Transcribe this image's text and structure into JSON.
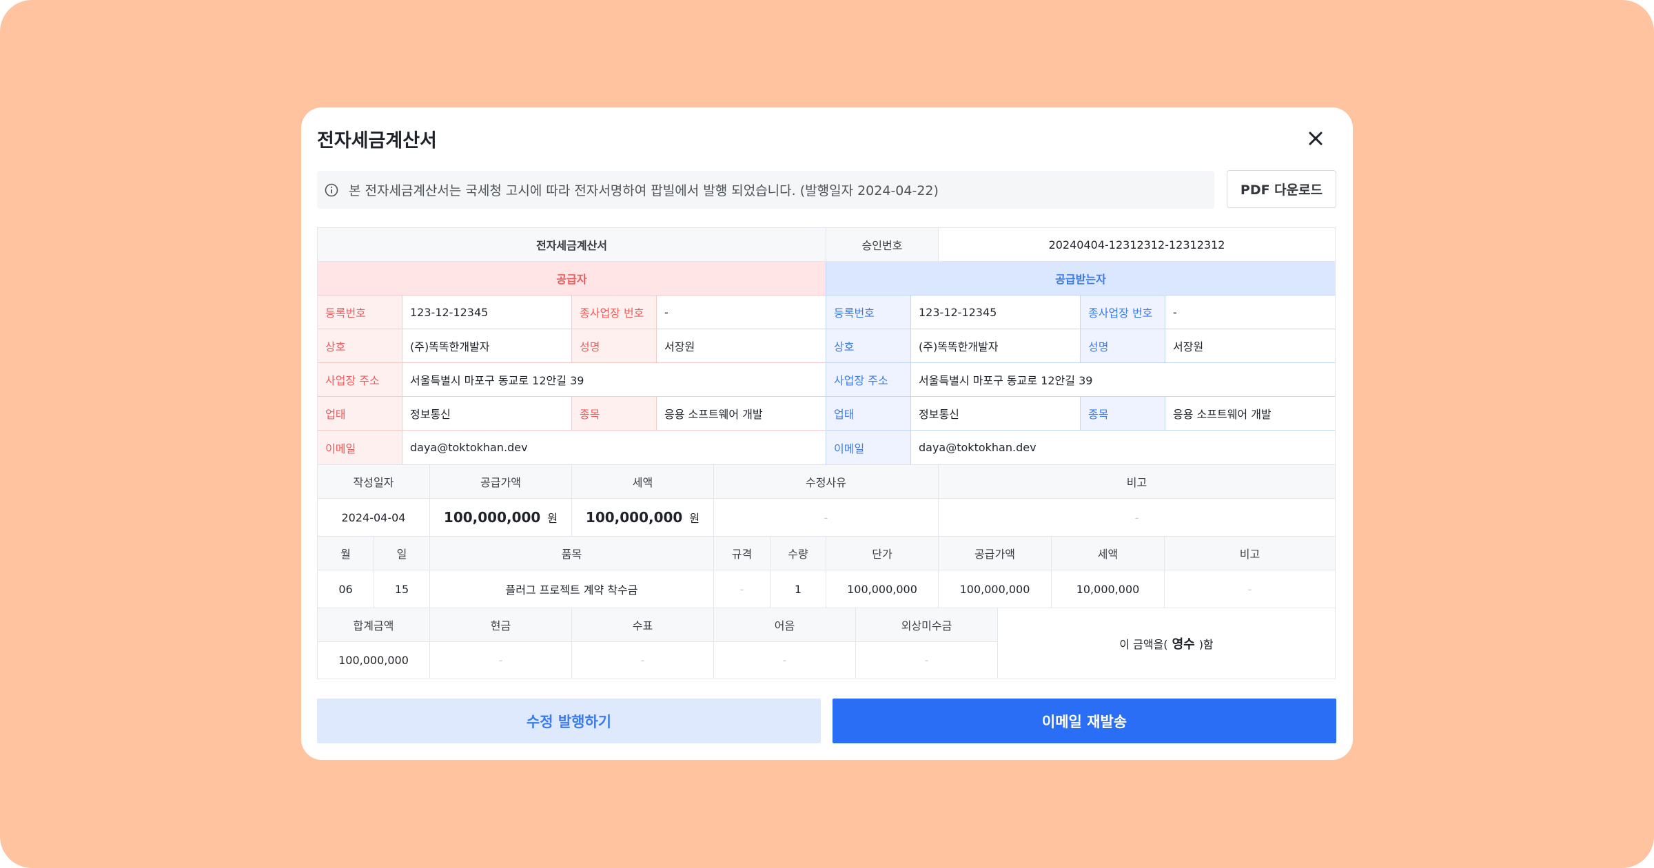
{
  "modal": {
    "title": "전자세금계산서",
    "notice": "본 전자세금계산서는 국세청 고시에 따라 전자서명하여 팝빌에서 발행 되었습니다. (발행일자 2024-04-22)",
    "pdf_button": "PDF 다운로드",
    "edit_button": "수정 발행하기",
    "email_button": "이메일 재발송",
    "icons": {
      "close": "close-icon",
      "info": "info-icon"
    }
  },
  "invoice": {
    "doc_title": "전자세금계산서",
    "approval_label": "승인번호",
    "approval_no": "20240404-12312312-12312312",
    "supplier": {
      "header": "공급자",
      "reg_label": "등록번호",
      "reg_no": "123-12-12345",
      "branch_label": "종사업장 번호",
      "branch_no": "-",
      "name_label": "상호",
      "name": "(주)똑똑한개발자",
      "rep_label": "성명",
      "rep": "서장원",
      "addr_label": "사업장 주소",
      "addr": "서울특별시 마포구 동교로 12안길 39",
      "type_label": "업태",
      "type": "정보통신",
      "item_label": "종목",
      "item": "응용 소프트웨어 개발",
      "email_label": "이메일",
      "email": "daya@toktokhan.dev"
    },
    "receiver": {
      "header": "공급받는자",
      "reg_label": "등록번호",
      "reg_no": "123-12-12345",
      "branch_label": "종사업장 번호",
      "branch_no": "-",
      "name_label": "상호",
      "name": "(주)똑똑한개발자",
      "rep_label": "성명",
      "rep": "서장원",
      "addr_label": "사업장 주소",
      "addr": "서울특별시 마포구 동교로 12안길 39",
      "type_label": "업태",
      "type": "정보통신",
      "item_label": "종목",
      "item": "응용 소프트웨어 개발",
      "email_label": "이메일",
      "email": "daya@toktokhan.dev"
    },
    "summary": {
      "headers": [
        "작성일자",
        "공급가액",
        "세액",
        "수정사유",
        "비고"
      ],
      "date": "2024-04-04",
      "supply_amount": "100,000,000",
      "tax_amount": "100,000,000",
      "unit": "원",
      "reason": "-",
      "note": "-"
    },
    "items": {
      "headers": [
        "월",
        "일",
        "품목",
        "규격",
        "수량",
        "단가",
        "공급가액",
        "세액",
        "비고"
      ],
      "row": {
        "month": "06",
        "day": "15",
        "name": "플러그 프로젝트 계약 착수금",
        "spec": "-",
        "qty": "1",
        "unit_price": "100,000,000",
        "supply": "100,000,000",
        "tax": "10,000,000",
        "note": "-"
      }
    },
    "totals": {
      "headers": [
        "합계금액",
        "현금",
        "수표",
        "어음",
        "외상미수금"
      ],
      "total": "100,000,000",
      "cash": "-",
      "check": "-",
      "note": "-",
      "credit": "-",
      "receipt_prefix": "이 금액을(",
      "receipt_word": "영수",
      "receipt_suffix": ")함"
    }
  }
}
